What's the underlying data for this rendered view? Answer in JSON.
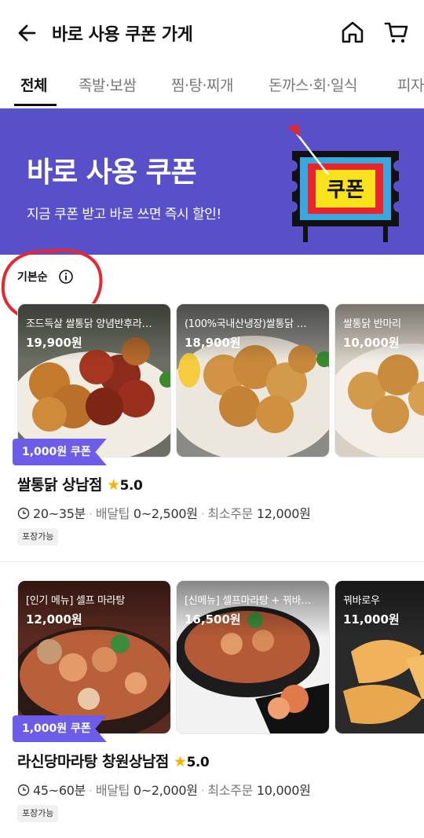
{
  "header": {
    "title": "바로 사용 쿠폰 가게",
    "back_icon": "arrow-left-icon",
    "home_icon": "home-icon",
    "cart_icon": "cart-icon"
  },
  "tabs": [
    {
      "label": "전체",
      "active": true
    },
    {
      "label": "족발·보쌈",
      "active": false
    },
    {
      "label": "찜·탕·찌개",
      "active": false
    },
    {
      "label": "돈까스·회·일식",
      "active": false
    },
    {
      "label": "피자",
      "active": false
    }
  ],
  "banner": {
    "title": "바로 사용 쿠폰",
    "subtitle": "지금 쿠폰 받고 바로 쓰면 즉시 할인!",
    "sign_text": "쿠폰",
    "bg_color": "#5750c9"
  },
  "sort": {
    "label": "기본순",
    "info_icon": "info-icon"
  },
  "stores": [
    {
      "items": [
        {
          "name": "조드득살 쌀통닭 양념반후라…",
          "price": "19,900원"
        },
        {
          "name": "(100%국내산냉장)쌀통닭 …",
          "price": "18,900원"
        },
        {
          "name": "쌀통닭 반마리",
          "price": "10,000원"
        }
      ],
      "coupon": "1,000원 쿠폰",
      "name": "쌀통닭 상남점",
      "rating": "5.0",
      "delivery_time": "20~35분",
      "delivery_tip_label": "배달팁",
      "delivery_tip": "0~2,500원",
      "min_order_label": "최소주문",
      "min_order": "12,000원",
      "badge": "포장가능"
    },
    {
      "items": [
        {
          "name": "[인기 메뉴] 셀프 마라탕",
          "price": "12,000원"
        },
        {
          "name": "[신메뉴] 셀프마라탕 + 꿔바…",
          "price": "16,500원"
        },
        {
          "name": "꿔바로우",
          "price": "11,000원"
        }
      ],
      "coupon": "1,000원 쿠폰",
      "name": "라신당마라탕 창원상남점",
      "rating": "5.0",
      "delivery_time": "45~60분",
      "delivery_tip_label": "배달팁",
      "delivery_tip": "0~2,000원",
      "min_order_label": "최소주문",
      "min_order": "10,000원",
      "badge": "포장가능"
    }
  ]
}
